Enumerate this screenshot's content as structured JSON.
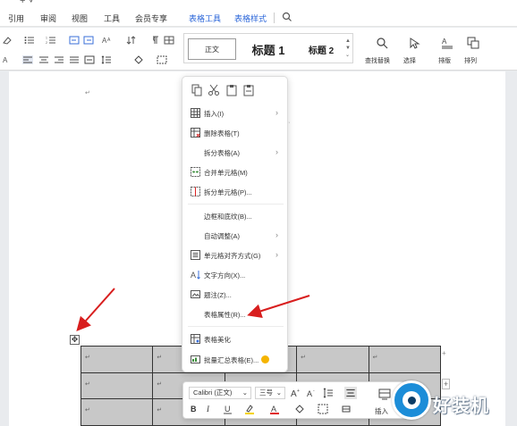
{
  "menubar": {
    "tabs": [
      {
        "label": "引用",
        "context": false
      },
      {
        "label": "审阅",
        "context": false
      },
      {
        "label": "视图",
        "context": false
      },
      {
        "label": "工具",
        "context": false
      },
      {
        "label": "会员专享",
        "context": false
      },
      {
        "label": "表格工具",
        "context": true
      },
      {
        "label": "表格样式",
        "context": true
      }
    ]
  },
  "ribbon": {
    "styles": {
      "normal": "正文",
      "heading1": "标题 1",
      "heading2": "标题 2"
    },
    "find_replace": "查找替换",
    "select": "选择",
    "layout": "排版",
    "arrange": "排列"
  },
  "context_menu": {
    "items": [
      {
        "label": "插入(I)",
        "icon": "table-insert-icon",
        "submenu": true
      },
      {
        "label": "删除表格(T)",
        "icon": "table-delete-icon",
        "submenu": false
      },
      {
        "label": "拆分表格(A)",
        "icon": "",
        "submenu": true
      },
      {
        "label": "合并单元格(M)",
        "icon": "merge-cells-icon",
        "submenu": false
      },
      {
        "label": "拆分单元格(P)...",
        "icon": "split-cells-icon",
        "submenu": false
      },
      {
        "label": "边框和底纹(B)...",
        "icon": "",
        "submenu": false
      },
      {
        "label": "自动调整(A)",
        "icon": "",
        "submenu": true
      },
      {
        "label": "单元格对齐方式(G)",
        "icon": "cell-align-icon",
        "submenu": true
      },
      {
        "label": "文字方向(X)...",
        "icon": "text-direction-icon",
        "submenu": false
      },
      {
        "label": "题注(Z)...",
        "icon": "caption-icon",
        "submenu": false
      },
      {
        "label": "表格属性(R)...",
        "icon": "",
        "submenu": false
      },
      {
        "label": "表格美化",
        "icon": "table-beautify-icon",
        "submenu": false
      },
      {
        "label": "批量汇总表格(E)...",
        "icon": "batch-summary-icon",
        "submenu": false
      }
    ]
  },
  "mini_toolbar": {
    "font_name": "Calibri (正文)",
    "font_size": "三号",
    "bold": "B",
    "italic": "I",
    "insert_label": "插入"
  },
  "table": {
    "rows": 3,
    "cols": 5
  },
  "watermark": {
    "text": "好装机"
  },
  "colors": {
    "context_tab": "#2b66d9",
    "table_fill": "#c8c8c8",
    "arrow": "#d81e1e",
    "highlight_yellow": "#f5d300",
    "font_red": "#e02020"
  }
}
